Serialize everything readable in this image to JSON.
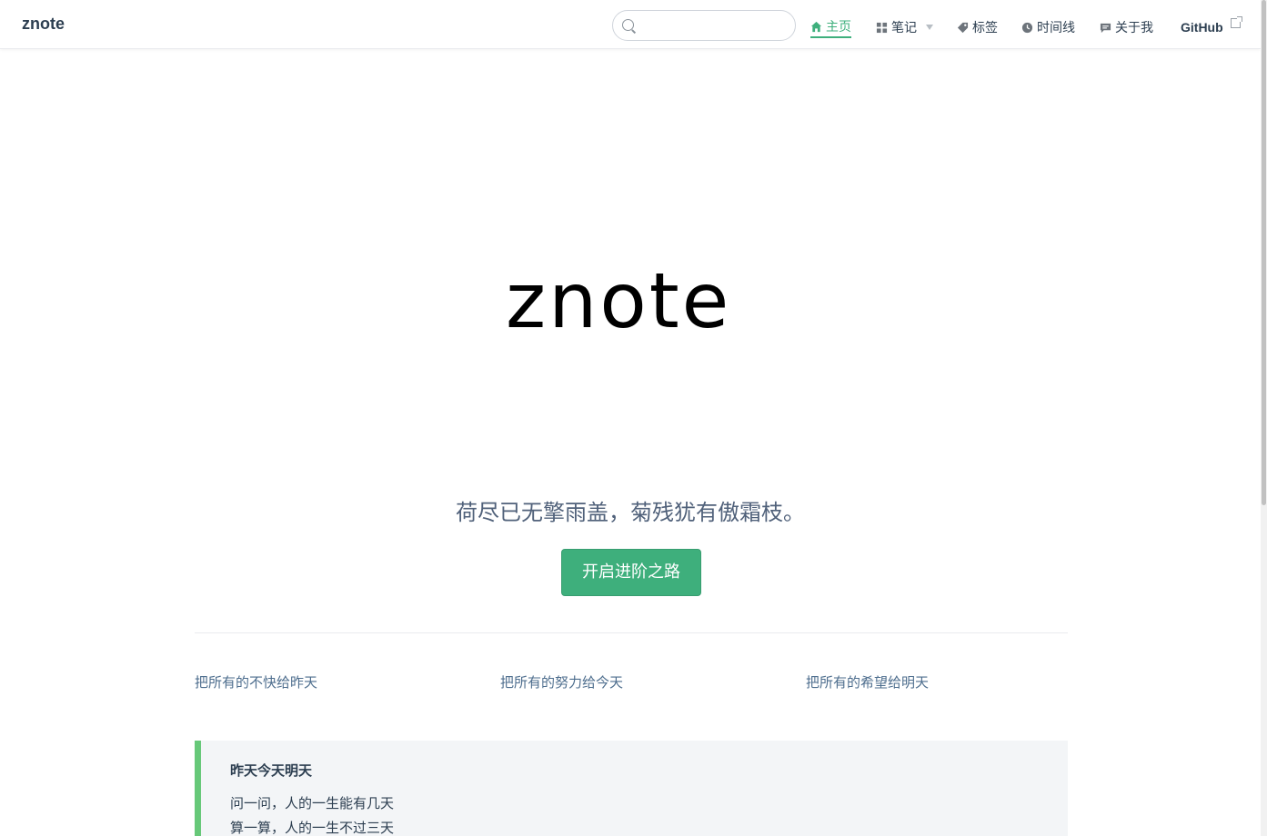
{
  "nav": {
    "site_name": "znote",
    "search": {
      "value": "",
      "placeholder": ""
    },
    "items": [
      {
        "label": "主页",
        "icon": "home-icon",
        "active": true
      },
      {
        "label": "笔记",
        "icon": "grid-icon",
        "dropdown": true
      },
      {
        "label": "标签",
        "icon": "tag-icon"
      },
      {
        "label": "时间线",
        "icon": "clock-icon"
      },
      {
        "label": "关于我",
        "icon": "message-icon"
      },
      {
        "label": "GitHub",
        "icon": "external-link-icon"
      }
    ],
    "accent_color": "#3eaf7c"
  },
  "hero": {
    "logo_text": "znote",
    "tagline": "荷尽已无擎雨盖，菊残犹有傲霜枝。",
    "action_label": "开启进阶之路"
  },
  "features": [
    {
      "title": "把所有的不快给昨天"
    },
    {
      "title": "把所有的努力给今天"
    },
    {
      "title": "把所有的希望给明天"
    }
  ],
  "quote": {
    "title": "昨天今天明天",
    "lines": [
      "问一问，人的一生能有几天",
      "算一算，人的一生不过三天"
    ]
  }
}
